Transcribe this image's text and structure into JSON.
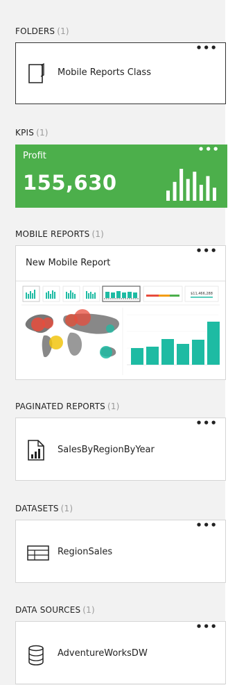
{
  "sections": {
    "folders": {
      "title": "FOLDERS",
      "count": "(1)",
      "item": {
        "label": "Mobile Reports Class",
        "icon": "folder-icon"
      }
    },
    "kpis": {
      "title": "KPIS",
      "count": "(1)",
      "item": {
        "name": "Profit",
        "value": "155,630",
        "trend_values": [
          14,
          26,
          44,
          30,
          40,
          22,
          34,
          18
        ]
      }
    },
    "mobile_reports": {
      "title": "MOBILE REPORTS",
      "count": "(1)",
      "item": {
        "label": "New Mobile Report",
        "thumbnail_value": "$11,466,288"
      }
    },
    "paginated_reports": {
      "title": "PAGINATED REPORTS",
      "count": "(1)",
      "item": {
        "label": "SalesByRegionByYear",
        "icon": "paginated-report-icon"
      }
    },
    "datasets": {
      "title": "DATASETS",
      "count": "(1)",
      "item": {
        "label": "RegionSales",
        "icon": "dataset-table-icon"
      }
    },
    "data_sources": {
      "title": "DATA SOURCES",
      "count": "(1)",
      "item": {
        "label": "AdventureWorksDW",
        "icon": "database-icon"
      }
    }
  },
  "more_label": "•••",
  "colors": {
    "kpi_green": "#4caf4b",
    "teal": "#1ebba3",
    "background": "#f2f2f2"
  }
}
